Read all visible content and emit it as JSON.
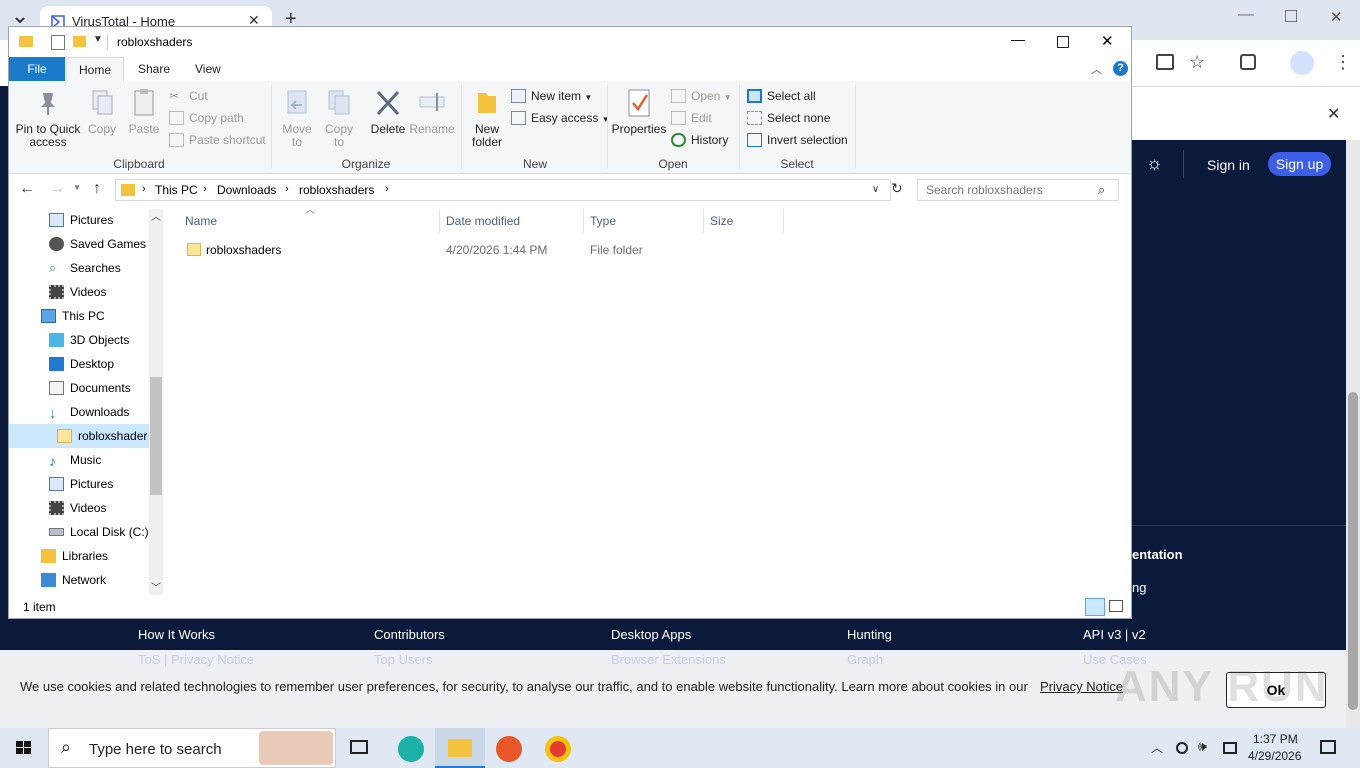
{
  "browser": {
    "tab_title": "VirusTotal - Home",
    "new_tab": "+",
    "signin": "Sign in",
    "signup": "Sign up",
    "vt_text_1": "entation",
    "vt_text_2": "ng"
  },
  "explorer": {
    "qat_title": "robloxshaders",
    "tabs": [
      "File",
      "Home",
      "Share",
      "View"
    ],
    "clipboard": {
      "pin": "Pin to Quick access",
      "copy": "Copy",
      "paste": "Paste",
      "cut": "Cut",
      "copy_path": "Copy path",
      "paste_shortcut": "Paste shortcut",
      "label": "Clipboard"
    },
    "organize": {
      "move_to": "Move to",
      "copy_to": "Copy to",
      "delete": "Delete",
      "rename": "Rename",
      "label": "Organize"
    },
    "new": {
      "new_folder": "New folder",
      "new_item": "New item",
      "easy_access": "Easy access",
      "label": "New"
    },
    "open": {
      "properties": "Properties",
      "open": "Open",
      "edit": "Edit",
      "history": "History",
      "label": "Open"
    },
    "select": {
      "select_all": "Select all",
      "select_none": "Select none",
      "invert": "Invert selection",
      "label": "Select"
    },
    "breadcrumb": [
      "This PC",
      "Downloads",
      "robloxshaders"
    ],
    "search_placeholder": "Search robloxshaders",
    "nav": [
      {
        "label": "Pictures",
        "icon": "pictures-icon"
      },
      {
        "label": "Saved Games",
        "icon": "saved-games-icon"
      },
      {
        "label": "Searches",
        "icon": "searches-icon"
      },
      {
        "label": "Videos",
        "icon": "videos-icon"
      },
      {
        "label": "This PC",
        "icon": "this-pc-icon"
      },
      {
        "label": "3D Objects",
        "icon": "3d-objects-icon"
      },
      {
        "label": "Desktop",
        "icon": "desktop-icon"
      },
      {
        "label": "Documents",
        "icon": "documents-icon"
      },
      {
        "label": "Downloads",
        "icon": "downloads-icon"
      },
      {
        "label": "robloxshader",
        "icon": "folder-icon"
      },
      {
        "label": "Music",
        "icon": "music-icon"
      },
      {
        "label": "Pictures",
        "icon": "pictures-icon"
      },
      {
        "label": "Videos",
        "icon": "videos-icon"
      },
      {
        "label": "Local Disk (C:)",
        "icon": "drive-icon"
      },
      {
        "label": "Libraries",
        "icon": "libraries-icon"
      },
      {
        "label": "Network",
        "icon": "network-icon"
      }
    ],
    "columns": [
      "Name",
      "Date modified",
      "Type",
      "Size"
    ],
    "files": [
      {
        "name": "robloxshaders",
        "date": "4/20/2026 1:44 PM",
        "type": "File folder",
        "size": ""
      }
    ],
    "status": "1 item"
  },
  "footer": {
    "links": [
      "How It Works",
      "Contributors",
      "Desktop Apps",
      "Hunting",
      "API v3 | v2"
    ],
    "sublinks": [
      "ToS | Privacy Notice",
      "Top Users",
      "Browser Extensions",
      "Graph",
      "Use Cases"
    ]
  },
  "cookie": {
    "text": "We use cookies and related technologies to remember user preferences, for security, to analyse our traffic, and to enable website functionality. Learn more about cookies in our",
    "link": "Privacy Notice",
    "ok": "Ok"
  },
  "taskbar": {
    "search_placeholder": "Type here to search",
    "time": "1:37 PM",
    "date": "4/29/2026"
  },
  "watermark": "ANY RUN",
  "colors": {
    "accent": "#1979ca",
    "vt_dark": "#0b1a3a",
    "signup": "#3d5ee6"
  }
}
